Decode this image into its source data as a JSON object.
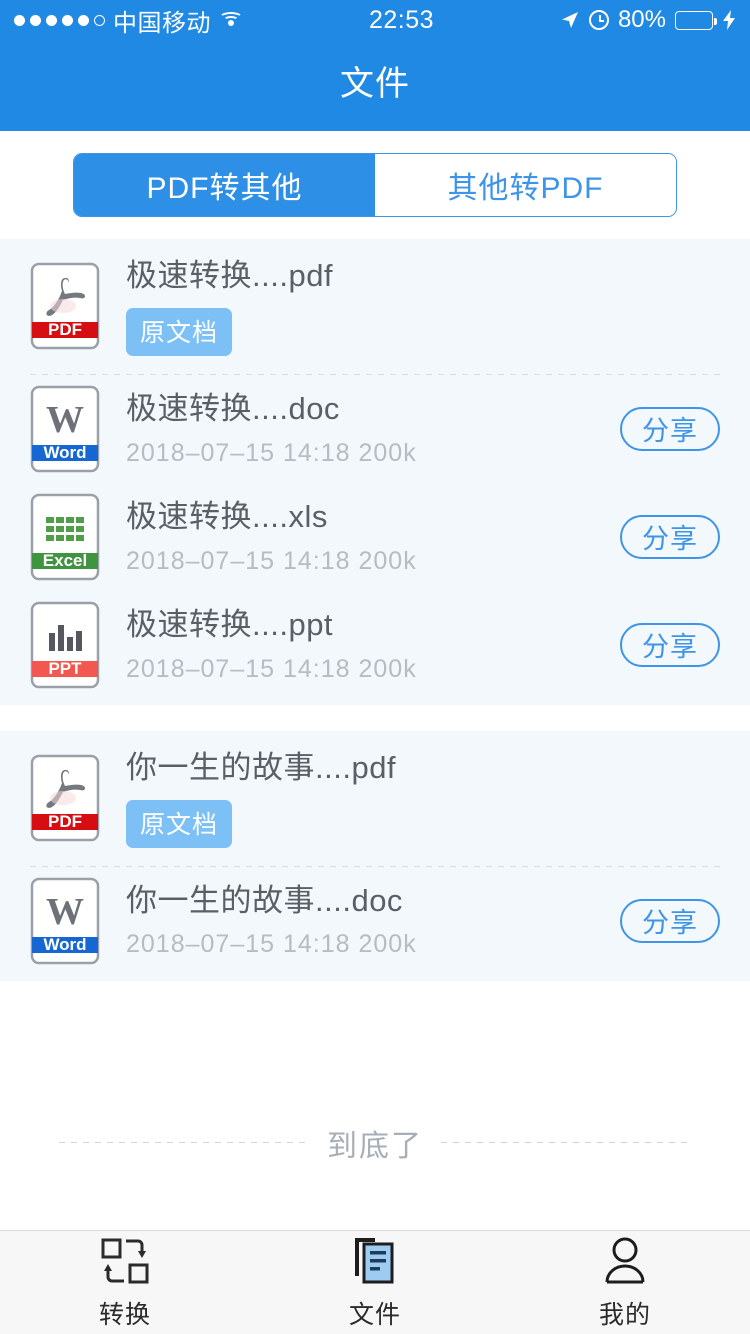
{
  "colors": {
    "brand_blue": "#2089e3",
    "seg_active": "#2e8fe6",
    "seg_border": "#3d94e8",
    "card_bg": "#f3f8fc",
    "badge_blue": "#7cc0f5",
    "battery_fill": "#5ae0dc",
    "pdf_red": "#d60d12",
    "word_blue": "#1667d4",
    "excel_green": "#3f9440",
    "ppt_red": "#f2584f"
  },
  "statusbar": {
    "carrier": "中国移动",
    "time": "22:53",
    "battery_percent": "80%",
    "battery_level": 80,
    "signal_dots_filled": 5,
    "signal_dots_total": 6,
    "icons": [
      "wifi-icon",
      "location-arrow-icon",
      "alarm-clock-icon",
      "battery-icon",
      "charging-bolt-icon"
    ]
  },
  "navbar": {
    "title": "文件"
  },
  "segmented": {
    "options": [
      {
        "label": "PDF转其他",
        "active": true
      },
      {
        "label": "其他转PDF",
        "active": false
      }
    ]
  },
  "groups": [
    {
      "source": {
        "icon": "pdf",
        "icon_label": "PDF",
        "name": "极速转换....pdf",
        "badge": "原文档"
      },
      "conversions": [
        {
          "icon": "word",
          "icon_label": "Word",
          "name": "极速转换....doc",
          "meta": "2018–07–15  14:18  200k",
          "share": "分享"
        },
        {
          "icon": "excel",
          "icon_label": "Excel",
          "name": "极速转换....xls",
          "meta": "2018–07–15  14:18  200k",
          "share": "分享"
        },
        {
          "icon": "ppt",
          "icon_label": "PPT",
          "name": "极速转换....ppt",
          "meta": "2018–07–15  14:18  200k",
          "share": "分享"
        }
      ]
    },
    {
      "source": {
        "icon": "pdf",
        "icon_label": "PDF",
        "name": "你一生的故事....pdf",
        "badge": "原文档"
      },
      "conversions": [
        {
          "icon": "word",
          "icon_label": "Word",
          "name": "你一生的故事....doc",
          "meta": "2018–07–15  14:18  200k",
          "share": "分享"
        }
      ]
    }
  ],
  "list_end": {
    "text": "到底了"
  },
  "tabbar": {
    "items": [
      {
        "label": "转换",
        "icon": "convert-icon",
        "active": false
      },
      {
        "label": "文件",
        "icon": "files-icon",
        "active": true
      },
      {
        "label": "我的",
        "icon": "profile-icon",
        "active": false
      }
    ]
  }
}
